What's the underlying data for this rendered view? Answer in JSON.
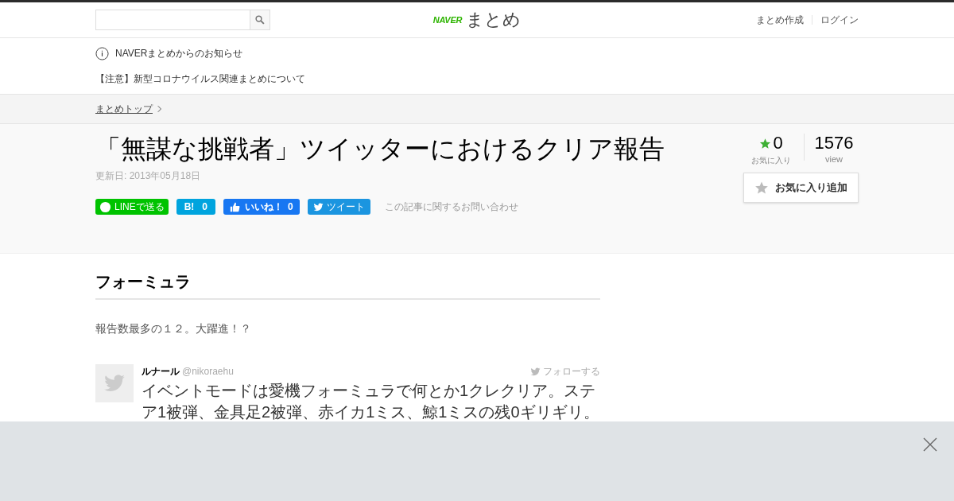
{
  "header": {
    "logo": {
      "brand": "NAVER",
      "name": "まとめ"
    },
    "links": [
      "まとめ作成",
      "ログイン"
    ]
  },
  "notice": {
    "title": "NAVERまとめからのお知らせ",
    "item": "【注意】新型コロナウイルス関連まとめについて"
  },
  "breadcrumb": [
    "まとめトップ"
  ],
  "article": {
    "title": "「無謀な挑戦者」ツイッターにおけるクリア報告",
    "updated": "更新日: 2013年05月18日",
    "share": [
      {
        "kind": "line",
        "label": "LINEで送る"
      },
      {
        "kind": "hatena",
        "label": "B!",
        "count": "0"
      },
      {
        "kind": "facebook",
        "label": "いいね！",
        "count": "0"
      },
      {
        "kind": "twitter",
        "label": "ツイート"
      }
    ],
    "contact": "この記事に関するお問い合わせ",
    "favorites": {
      "count": "0",
      "label": "お気に入り"
    },
    "views": {
      "count": "1576",
      "label": "view"
    },
    "add_favorite": "お気に入り追加"
  },
  "content": {
    "heading": "フォーミュラ",
    "text": "報告数最多の１２。大躍進！？",
    "tweet": {
      "name": "ルナール",
      "handle": "@nikoraehu",
      "follow": "フォローする",
      "text": "イベントモードは愛機フォーミュラで何とか1クレクリア。ステア1被弾、金具足2被弾、赤イカ1ミス、鯨1ミスの残0ギリギリ。"
    }
  },
  "overlay": {
    "kind": "ad"
  }
}
